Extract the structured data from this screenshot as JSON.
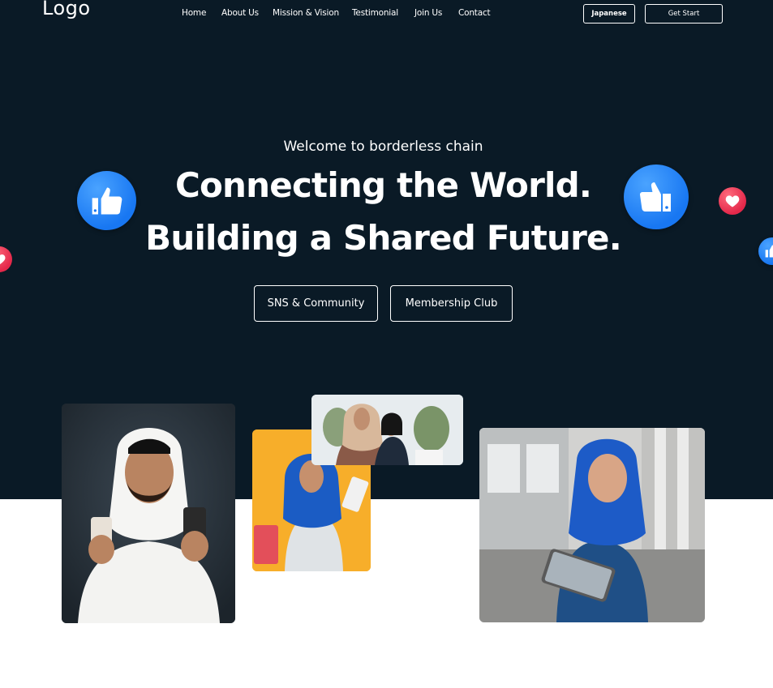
{
  "header": {
    "logo": "Logo",
    "nav": [
      "Home",
      "About Us",
      "Mission & Vision",
      "Testimonial",
      "Join Us",
      "Contact"
    ],
    "language_button": "Japanese",
    "cta_button": "Get Start"
  },
  "hero": {
    "welcome": "Welcome to borderless chain",
    "headline_line1": "Connecting the World.",
    "headline_line2": "Building a Shared Future.",
    "buttons": [
      "SNS & Community",
      "Membership Club"
    ]
  },
  "decorations": {
    "icons": [
      "thumbs-up-icon",
      "heart-icon"
    ],
    "colors": {
      "like": "#1877f2",
      "heart": "#e4284a",
      "hero_bg": "#0a1a26"
    }
  },
  "gallery": {
    "photos": [
      "man-in-ghutra-photo",
      "woman-shopping-photo",
      "women-with-laptop-photo",
      "woman-with-tablet-photo"
    ]
  }
}
